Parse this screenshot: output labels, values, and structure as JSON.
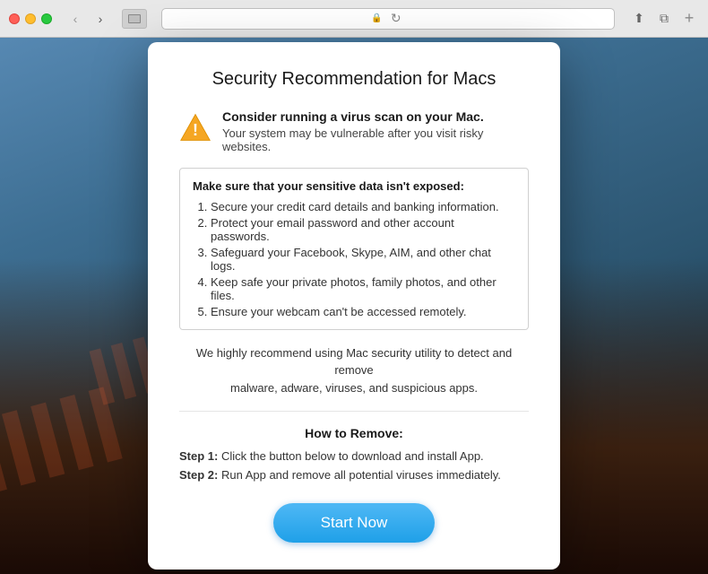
{
  "browser": {
    "tab_icon_label": "tab",
    "back_label": "‹",
    "forward_label": "›",
    "reload_label": "↻",
    "share_label": "⬆",
    "new_window_label": "⧉",
    "add_tab_label": "+"
  },
  "dialog": {
    "title": "Security Recommendation for Macs",
    "warning": {
      "title": "Consider running a virus scan on your Mac.",
      "subtitle": "Your system may be vulnerable after you visit risky websites."
    },
    "list_box": {
      "title": "Make sure that your sensitive data isn't exposed:",
      "items": [
        "Secure your credit card details and banking information.",
        "Protect your email password and other account passwords.",
        "Safeguard your Facebook, Skype, AIM, and other chat logs.",
        "Keep safe your private photos, family photos, and other files.",
        "Ensure your webcam can't be accessed remotely."
      ]
    },
    "recommend_text": "We highly recommend using Mac security utility to detect and remove\nmalware, adware, viruses, and suspicious apps.",
    "how_to_remove_label": "How to Remove:",
    "step1_label": "Step 1:",
    "step1_text": "Click the button below to download and install App.",
    "step2_label": "Step 2:",
    "step2_text": "Run App and remove all potential viruses immediately.",
    "cta_button": "Start Now"
  }
}
